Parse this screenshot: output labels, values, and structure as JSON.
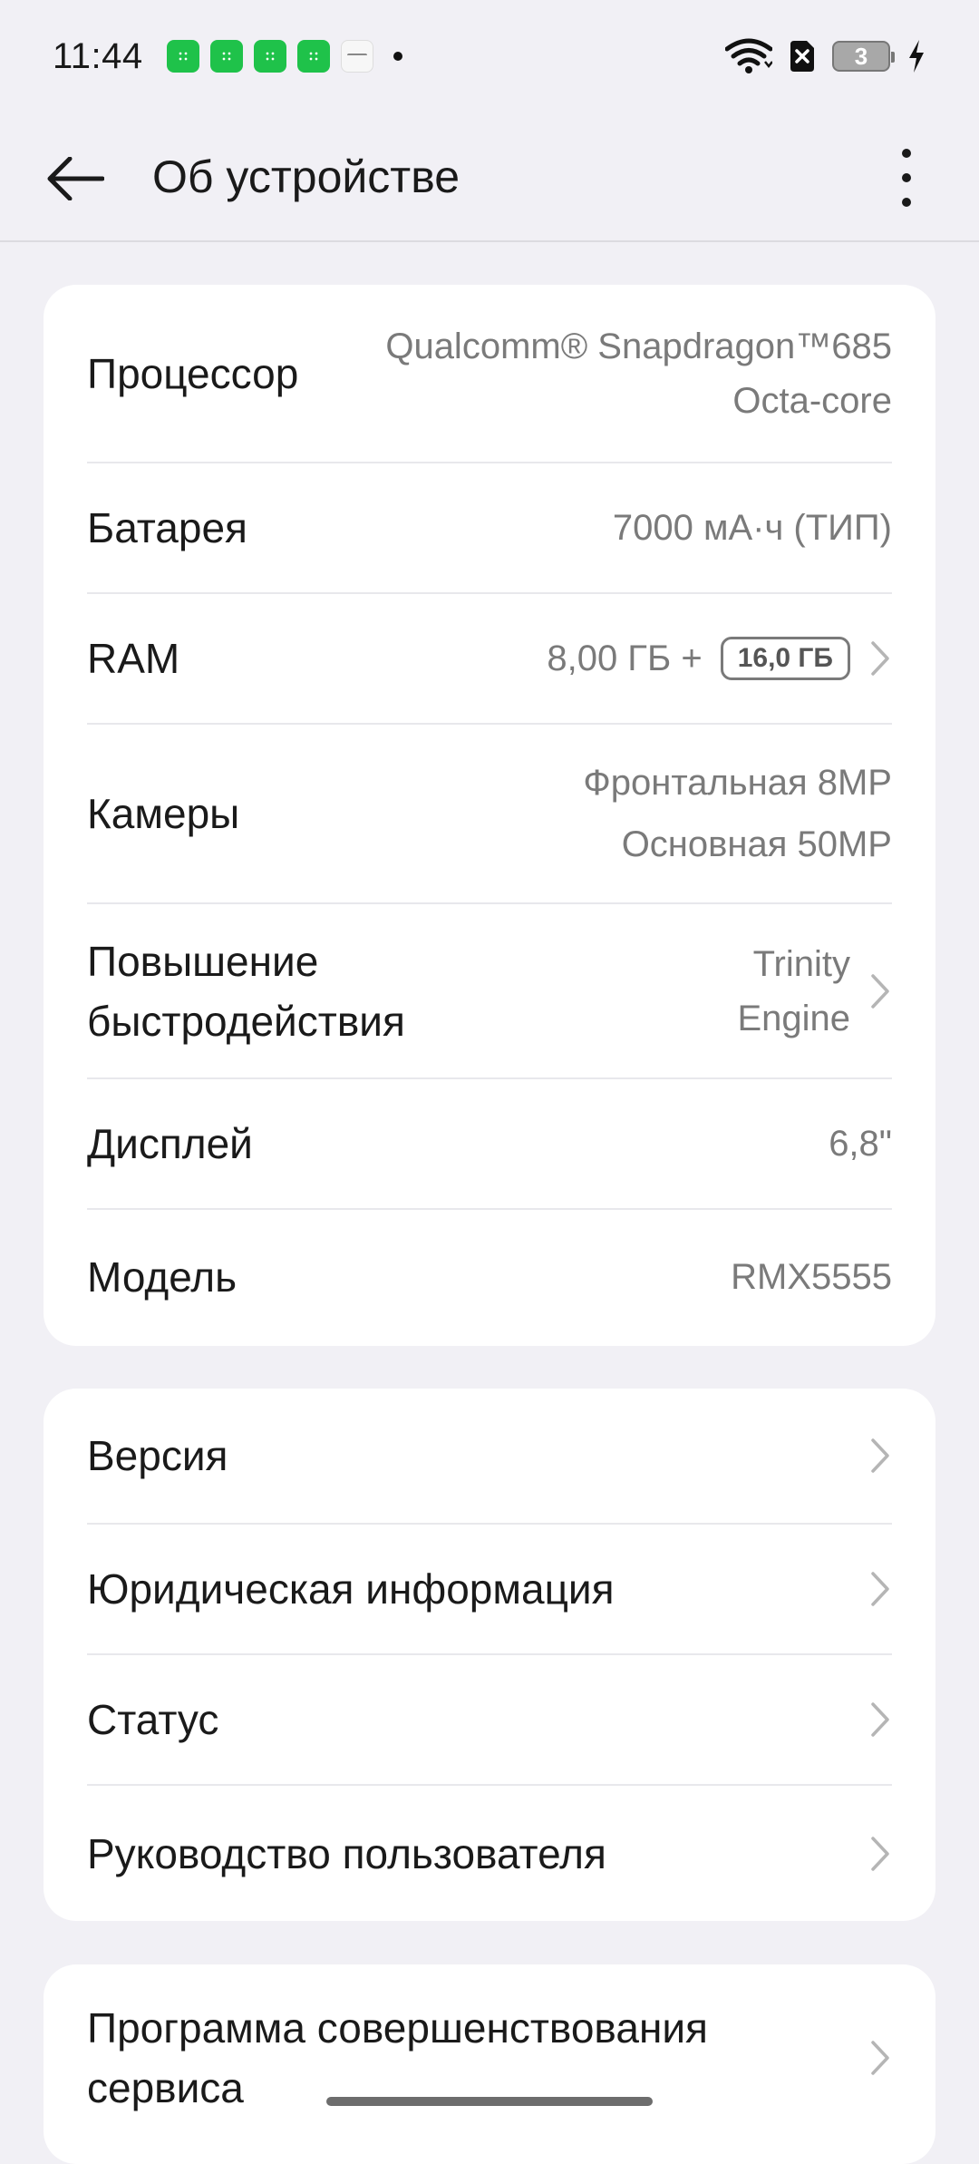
{
  "status_bar": {
    "time": "11:44",
    "battery_level": "3",
    "notification_icons": [
      "app-store-icon",
      "app-store-icon",
      "app-store-icon",
      "app-store-icon",
      "realme-icon"
    ]
  },
  "header": {
    "title": "Об устройстве"
  },
  "specs": {
    "processor": {
      "label": "Процессор",
      "value_line1": "Qualcomm® Snapdragon™685",
      "value_line2": "Octa-core"
    },
    "battery": {
      "label": "Батарея",
      "value": "7000 мА·ч (ТИП)"
    },
    "ram": {
      "label": "RAM",
      "value": "8,00 ГБ +",
      "badge": "16,0 ГБ"
    },
    "cameras": {
      "label": "Камеры",
      "value_line1": "Фронтальная 8MP",
      "value_line2": "Основная 50MP"
    },
    "performance": {
      "label_line1": "Повышение",
      "label_line2": "быстродействия",
      "value_line1": "Trinity",
      "value_line2": "Engine"
    },
    "display": {
      "label": "Дисплей",
      "value": "6,8\""
    },
    "model": {
      "label": "Модель",
      "value": "RMX5555"
    }
  },
  "info_menu": {
    "version": "Версия",
    "legal": "Юридическая информация",
    "status": "Статус",
    "user_guide": "Руководство пользователя"
  },
  "program": {
    "label_line1": "Программа совершенствования",
    "label_line2": "сервиса"
  },
  "colors": {
    "background": "#f1f0f5",
    "card": "#ffffff",
    "primary_text": "#1a1a1a",
    "secondary_text": "#7a7a7a"
  }
}
